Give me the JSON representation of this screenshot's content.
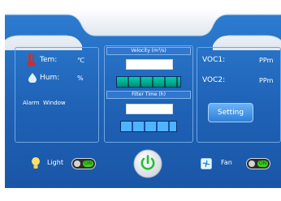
{
  "colors": {
    "primary_blue": "#1f62b6",
    "panel_border": "#6fa6e6",
    "bar_green": "#00d7c2",
    "bar_blue": "#4fb3ff",
    "power_green": "#22c12f",
    "toggle_on_green": "#39d11f"
  },
  "left_panel": {
    "temp_label": "Tem:",
    "temp_unit": "℃",
    "hum_label": "Hum:",
    "hum_unit": "%",
    "alarm_text": "Alarm  Window"
  },
  "center_panel": {
    "velocity_label": "Velocity (m³/s)",
    "velocity_value": "",
    "filter_label": "Filter Time (h)",
    "filter_value": ""
  },
  "right_panel": {
    "voc1_label": "VOC1:",
    "voc1_unit": "PPm",
    "voc2_label": "VOC2:",
    "voc2_unit": "PPm",
    "setting_label": "Setting"
  },
  "bottom_bar": {
    "light_label": "Light",
    "light_toggle_text": "ON",
    "fan_label": "Fan",
    "fan_toggle_text": "ON"
  },
  "icons": {
    "thermometer": "thermometer-icon",
    "water_drop": "water-drop-icon",
    "lightbulb": "lightbulb-icon",
    "fan": "fan-icon",
    "power": "power-icon"
  }
}
